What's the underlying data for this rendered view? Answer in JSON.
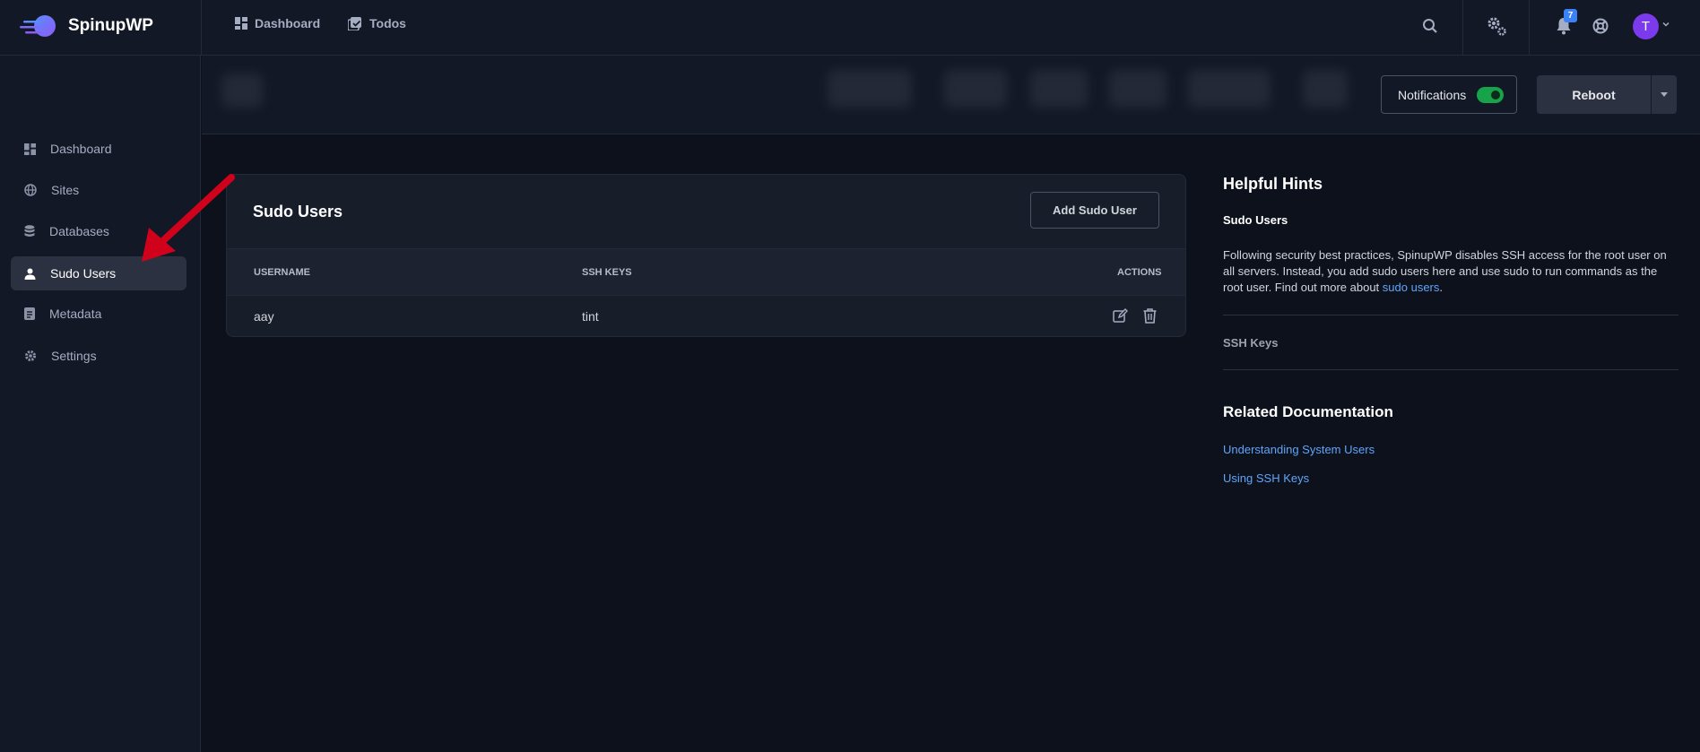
{
  "app": {
    "brand": "SpinupWP"
  },
  "topnav": {
    "items": [
      {
        "label": "Dashboard",
        "icon": "dashboard-icon"
      },
      {
        "label": "Todos",
        "icon": "todos-icon"
      }
    ],
    "notifications_count": "7",
    "avatar_initial": "T"
  },
  "sidebar": {
    "items": [
      {
        "label": "Dashboard",
        "icon": "dashboard-icon"
      },
      {
        "label": "Sites",
        "icon": "globe-icon"
      },
      {
        "label": "Databases",
        "icon": "database-icon"
      },
      {
        "label": "Sudo Users",
        "icon": "user-icon",
        "active": true
      },
      {
        "label": "Metadata",
        "icon": "metadata-icon"
      },
      {
        "label": "Settings",
        "icon": "gear-icon"
      }
    ]
  },
  "server_bar": {
    "notifications_label": "Notifications",
    "notifications_on": true,
    "reboot_label": "Reboot"
  },
  "sudo_users": {
    "title": "Sudo Users",
    "add_button": "Add Sudo User",
    "columns": [
      "USERNAME",
      "SSH KEYS",
      "ACTIONS"
    ],
    "rows": [
      {
        "username": "aay",
        "ssh_keys": "tint"
      }
    ]
  },
  "hints": {
    "title": "Helpful Hints",
    "subtitle": "Sudo Users",
    "body_text": "Following security best practices, SpinupWP disables SSH access for the root user on all servers. Instead, you add sudo users here and use sudo to run commands as the root user. Find out more about ",
    "body_link": "sudo users",
    "body_end": ".",
    "ssh_keys": "SSH Keys",
    "related_title": "Related Documentation",
    "docs": [
      "Understanding System Users",
      "Using SSH Keys"
    ]
  },
  "colors": {
    "accent": "#60a5fa",
    "toggle_on": "#16a34a",
    "avatar": "#7c3aed",
    "annotation_arrow": "#d0021b"
  }
}
